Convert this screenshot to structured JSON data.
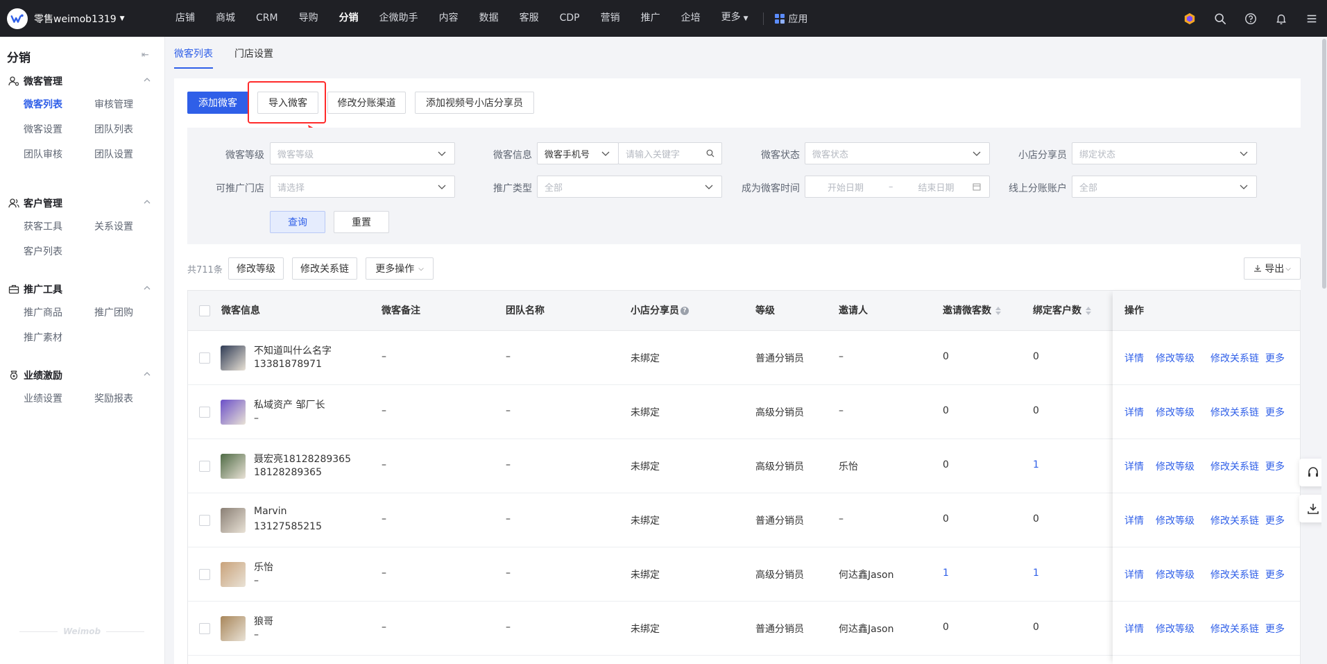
{
  "topbar": {
    "brand": "零售weimob1319",
    "nav": [
      "店铺",
      "商城",
      "CRM",
      "导购",
      "分销",
      "企微助手",
      "内容",
      "数据",
      "客服",
      "CDP",
      "营销",
      "推广",
      "企培"
    ],
    "active_nav": "分销",
    "more": "更多",
    "apps": "应用"
  },
  "sidebar": {
    "title": "分销",
    "groups": [
      {
        "title": "微客管理",
        "icon": "user-settings-icon",
        "items": [
          "微客列表",
          "审核管理",
          "微客设置",
          "团队列表",
          "团队审核",
          "团队设置"
        ]
      },
      {
        "title": "客户管理",
        "icon": "users-icon",
        "items": [
          "获客工具",
          "关系设置",
          "客户列表"
        ]
      },
      {
        "title": "推广工具",
        "icon": "briefcase-icon",
        "items": [
          "推广商品",
          "推广团购",
          "推广素材"
        ]
      },
      {
        "title": "业绩激励",
        "icon": "medal-icon",
        "items": [
          "业绩设置",
          "奖励报表"
        ]
      }
    ],
    "active_item": "微客列表",
    "footer": "Weimob"
  },
  "subtabs": [
    "微客列表",
    "门店设置"
  ],
  "actions": {
    "add": "添加微客",
    "import": "导入微客",
    "modify_channel": "修改分账渠道",
    "add_video": "添加视频号小店分享员"
  },
  "filters": {
    "level_label": "微客等级",
    "level_placeholder": "微客等级",
    "info_label": "微客信息",
    "info_type": "微客手机号",
    "info_placeholder": "请输入关键字",
    "status_label": "微客状态",
    "status_placeholder": "微客状态",
    "sharer_label": "小店分享员",
    "sharer_placeholder": "绑定状态",
    "store_label": "可推广门店",
    "store_placeholder": "请选择",
    "type_label": "推广类型",
    "type_value": "全部",
    "time_label": "成为微客时间",
    "start_placeholder": "开始日期",
    "date_sep": "–",
    "end_placeholder": "结束日期",
    "account_label": "线上分账账户",
    "account_value": "全部",
    "query": "查询",
    "reset": "重置"
  },
  "toolbar": {
    "count": "共711条",
    "modify_level": "修改等级",
    "modify_chain": "修改关系链",
    "more_ops": "更多操作",
    "export": "导出"
  },
  "table": {
    "columns": [
      "微客信息",
      "微客备注",
      "团队名称",
      "小店分享员",
      "等级",
      "邀请人",
      "邀请微客数",
      "绑定客户数",
      "操作"
    ],
    "ops": [
      "详情",
      "修改等级",
      "修改关系链",
      "更多"
    ],
    "rows": [
      {
        "name": "不知道叫什么名字",
        "phone": "13381878971",
        "note": "–",
        "team": "–",
        "sharer": "未绑定",
        "level": "普通分销员",
        "inviter": "–",
        "invited": "0",
        "bound": "0",
        "avatar_color": "#2f3b55"
      },
      {
        "name": "私域资产 邹厂长",
        "phone": "–",
        "note": "–",
        "team": "–",
        "sharer": "未绑定",
        "level": "高级分销员",
        "inviter": "–",
        "invited": "0",
        "bound": "0",
        "avatar_color": "#6b4fc8"
      },
      {
        "name": "聂宏亮18128289365",
        "phone": "18128289365",
        "note": "–",
        "team": "–",
        "sharer": "未绑定",
        "level": "高级分销员",
        "inviter": "乐怡",
        "invited": "0",
        "bound": "1",
        "avatar_color": "#4f6b45"
      },
      {
        "name": "Marvin",
        "phone": "13127585215",
        "note": "–",
        "team": "–",
        "sharer": "未绑定",
        "level": "普通分销员",
        "inviter": "–",
        "invited": "0",
        "bound": "0",
        "avatar_color": "#8a7f75"
      },
      {
        "name": "乐怡",
        "phone": "–",
        "note": "–",
        "team": "–",
        "sharer": "未绑定",
        "level": "高级分销员",
        "inviter": "何达鑫Jason",
        "invited": "1",
        "bound": "1",
        "avatar_color": "#c9a27a"
      },
      {
        "name": "狼哥",
        "phone": "–",
        "note": "–",
        "team": "–",
        "sharer": "未绑定",
        "level": "普通分销员",
        "inviter": "何达鑫Jason",
        "invited": "0",
        "bound": "0",
        "avatar_color": "#a8865a"
      }
    ]
  },
  "colors": {
    "primary": "#2f5fe8",
    "topbar": "#1f2025",
    "highlight": "#ff2a2a"
  }
}
